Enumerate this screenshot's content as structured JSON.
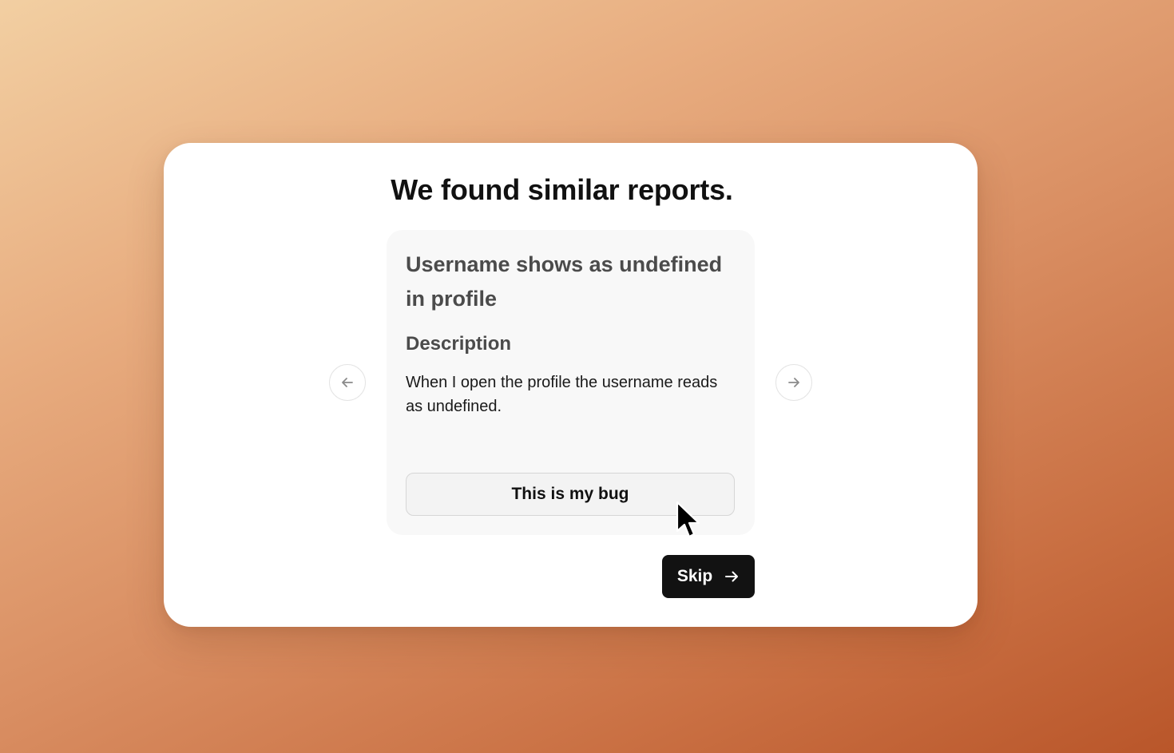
{
  "modal": {
    "title": "We found similar reports."
  },
  "report": {
    "title": "Username shows as undefined in profile",
    "section_heading": "Description",
    "description": "When I open the profile the username reads as undefined.",
    "action_label": "This is my bug"
  },
  "navigation": {
    "prev_icon": "arrow-left-icon",
    "next_icon": "arrow-right-icon"
  },
  "footer": {
    "skip_label": "Skip",
    "skip_icon": "arrow-right-icon"
  },
  "colors": {
    "primary_button": "#121212",
    "card_background": "#f8f8f8"
  }
}
